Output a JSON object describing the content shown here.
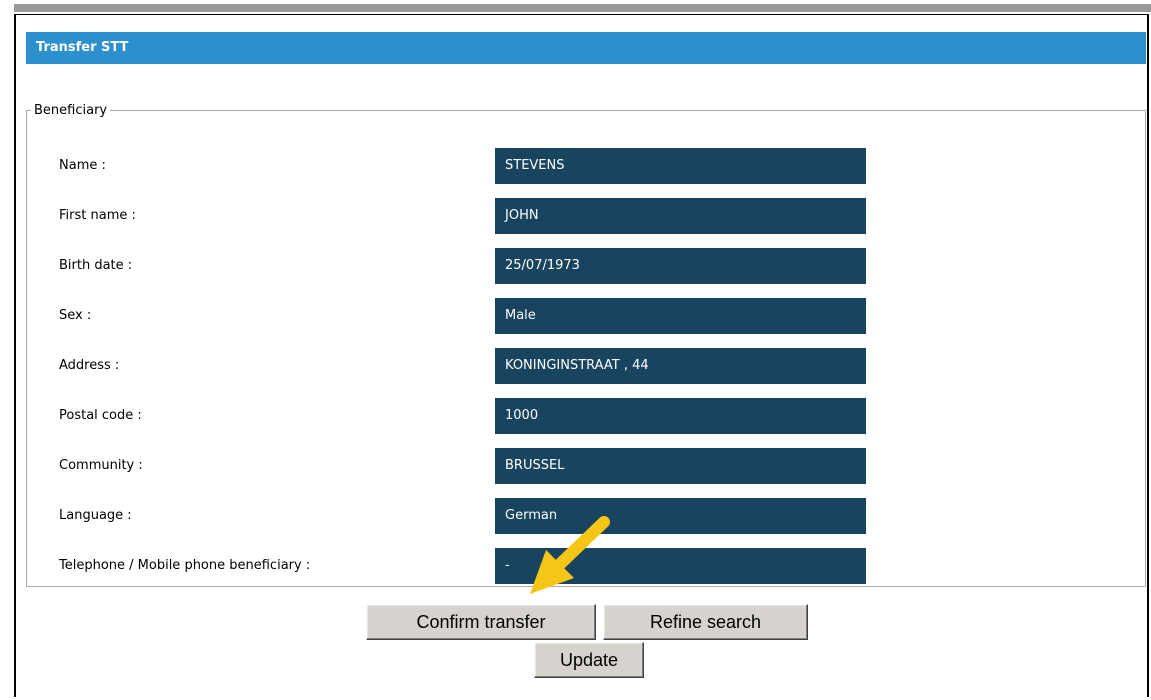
{
  "panel": {
    "title": "Transfer STT"
  },
  "beneficiary": {
    "legend": "Beneficiary",
    "fields": [
      {
        "label": "Name :",
        "value": "STEVENS"
      },
      {
        "label": "First name :",
        "value": "JOHN"
      },
      {
        "label": "Birth date :",
        "value": "25/07/1973"
      },
      {
        "label": "Sex :",
        "value": "Male"
      },
      {
        "label": "Address :",
        "value": "KONINGINSTRAAT , 44"
      },
      {
        "label": "Postal code :",
        "value": "1000"
      },
      {
        "label": "Community :",
        "value": "BRUSSEL"
      },
      {
        "label": "Language :",
        "value": "German"
      },
      {
        "label": "Telephone / Mobile phone beneficiary :",
        "value": "-"
      }
    ]
  },
  "actions": {
    "confirm_label": "Confirm transfer",
    "refine_label": "Refine search",
    "update_label": "Update"
  },
  "colors": {
    "title_bar": "#2b90cd",
    "value_box": "#18445f",
    "annotation_arrow": "#f5c518"
  },
  "annotation": {
    "icon": "pointer-arrow-icon"
  }
}
